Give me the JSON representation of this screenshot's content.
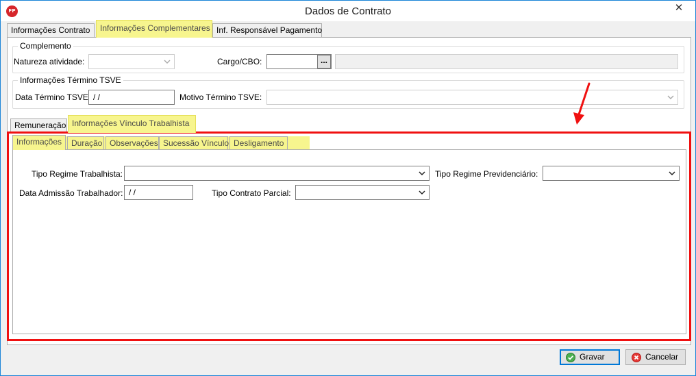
{
  "window": {
    "title": "Dados de Contrato",
    "app_icon_text": "FP",
    "close_glyph": "✕"
  },
  "top_tabs": [
    {
      "label": "Informações Contrato"
    },
    {
      "label": "Informações Complementares"
    },
    {
      "label": "Inf. Responsável Pagamento"
    }
  ],
  "complemento": {
    "legend": "Complemento",
    "natureza_label": "Natureza atividade:",
    "natureza_value": "",
    "cargo_label": "Cargo/CBO:",
    "cargo_value": "",
    "cargo_button": "...",
    "cargo_description": ""
  },
  "termino": {
    "legend": "Informações Término TSVE",
    "data_label": "Data Término TSVE:",
    "data_value": " /  /",
    "motivo_label": "Motivo Término TSVE:",
    "motivo_value": ""
  },
  "mid_tabs": [
    {
      "label": "Remuneração"
    },
    {
      "label": "Informações Vínculo Trabalhista"
    }
  ],
  "inner_tabs": [
    {
      "label": "Informações"
    },
    {
      "label": "Duração"
    },
    {
      "label": "Observações"
    },
    {
      "label": "Sucessão Vínculo"
    },
    {
      "label": "Desligamento"
    }
  ],
  "informacoes": {
    "tipo_regime_trabalhista_label": "Tipo Regime Trabalhista:",
    "tipo_regime_trabalhista_value": "",
    "tipo_regime_previdenciario_label": "Tipo Regime Previdenciário:",
    "tipo_regime_previdenciario_value": "",
    "data_admissao_label": "Data Admissão Trabalhador:",
    "data_admissao_value": " /  /",
    "tipo_contrato_parcial_label": "Tipo Contrato Parcial:",
    "tipo_contrato_parcial_value": ""
  },
  "footer": {
    "save_label": "Gravar",
    "cancel_label": "Cancelar"
  },
  "colors": {
    "highlight": "#f7f58e",
    "annotation_red": "#f01010",
    "window_border": "#1883d7"
  }
}
